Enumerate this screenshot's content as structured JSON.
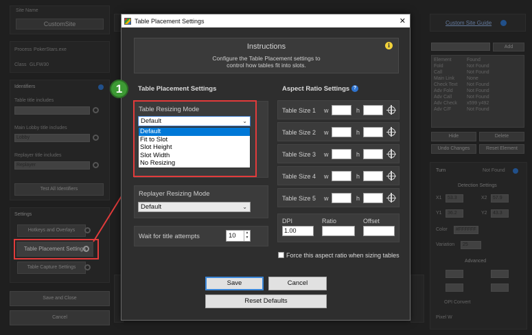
{
  "background": {
    "site_name_label": "Site Name",
    "site_name_value": "CustomSite",
    "process_label": "Process",
    "process_value": "PokerStars.exe",
    "class_label": "Class",
    "class_value": "GLFW30",
    "identifiers_title": "Identifiers",
    "table_title_label": "Table title includes",
    "main_lobby_label": "Main Lobby title includes",
    "main_lobby_value": "Lobby",
    "replayer_label": "Replayer title includes",
    "replayer_value": "Replayer",
    "test_all_button": "Test All Identifiers",
    "settings_title": "Settings",
    "hotkeys_button": "Hotkeys and Overlays",
    "table_placement_button": "Table Placement Settings",
    "table_capture_button": "Table Capture Settings",
    "save_close_button": "Save and Close",
    "cancel_button": "Cancel",
    "site_guide_link": "Custom Site Guide",
    "add_button": "Add",
    "element_header": "Element",
    "found_header": "Found",
    "elements": [
      {
        "name": "Fold",
        "status": "Not Found"
      },
      {
        "name": "Call",
        "status": "Not Found"
      },
      {
        "name": "Main Link",
        "status": "None"
      },
      {
        "name": "Check Text",
        "status": "Not Found"
      },
      {
        "name": "Adv Fold",
        "status": "Not Found"
      },
      {
        "name": "Adv Call",
        "status": "Not Found"
      },
      {
        "name": "Adv Check",
        "status": "x599 y492"
      },
      {
        "name": "Adv C/F",
        "status": "Not Found"
      }
    ],
    "hide_button": "Hide",
    "delete_button": "Delete",
    "undo_button": "Undo Changes",
    "reset_element_button": "Reset Element",
    "turn_label": "Turn",
    "turn_status": "Not Found",
    "detection_title": "Detection Settings",
    "x1_label": "X1",
    "x1_value": "53.3",
    "x2_label": "X2",
    "x2_value": "57.9",
    "y1_label": "Y1",
    "y1_value": "36.2",
    "y2_label": "Y2",
    "y2_value": "43.3",
    "color_label": "Color",
    "color_value": "#FFFFFF",
    "variation_label": "Variation",
    "variation_value": "25",
    "advanced_title": "Advanced",
    "opi_convert_label": "OPI Convert",
    "pixel_label": "Pixel W"
  },
  "dialog": {
    "title": "Table Placement Settings",
    "close_glyph": "✕",
    "instructions_title": "Instructions",
    "instructions_line1": "Configure the Table Placement settings to",
    "instructions_line2": "control how tables fit into slots.",
    "info_glyph": "i",
    "left_section_title": "Table Placement Settings",
    "table_resizing_label": "Table Resizing Mode",
    "table_resizing_value": "Default",
    "table_resizing_options": [
      "Default",
      "Fit to Slot",
      "Slot Height",
      "Slot Width",
      "No Resizing"
    ],
    "replayer_resizing_label": "Replayer Resizing Mode",
    "replayer_resizing_value": "Default",
    "wait_label": "Wait for title attempts",
    "wait_value": "10",
    "right_section_title": "Aspect Ratio Settings",
    "help_glyph": "?",
    "table_sizes": [
      {
        "label": "Table Size 1",
        "w": "w",
        "h": "h"
      },
      {
        "label": "Table Size 2",
        "w": "w",
        "h": "h"
      },
      {
        "label": "Table Size 3",
        "w": "w",
        "h": "h"
      },
      {
        "label": "Table Size 4",
        "w": "w",
        "h": "h"
      },
      {
        "label": "Table Size 5",
        "w": "w",
        "h": "h"
      }
    ],
    "dpi_label": "DPI",
    "dpi_value": "1.00",
    "ratio_label": "Ratio",
    "offset_label": "Offset",
    "force_aspect_label": "Force this aspect ratio when sizing tables",
    "save_button": "Save",
    "cancel_button": "Cancel",
    "reset_defaults_button": "Reset Defaults"
  },
  "annotation": {
    "step_number": "1",
    "highlight_color": "#e33b3b",
    "step_color": "#3d9a34"
  }
}
